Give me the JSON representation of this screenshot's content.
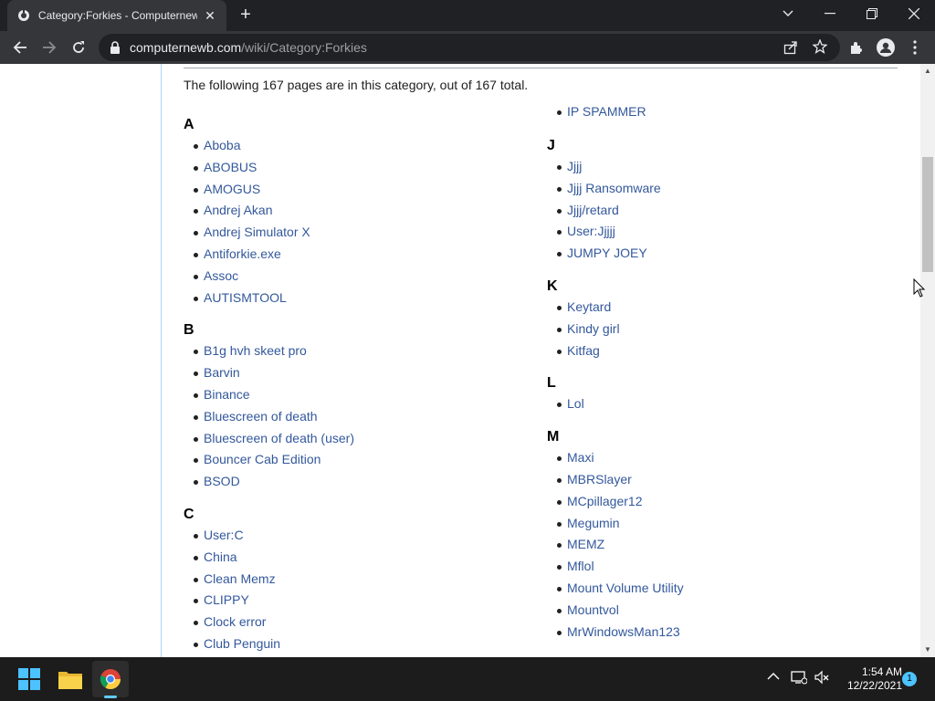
{
  "browser": {
    "tab_title": "Category:Forkies - Computernewb",
    "tab_close": "✕",
    "new_tab": "+",
    "url_host": "computernewb.com",
    "url_path": "/wiki/Category:Forkies"
  },
  "page": {
    "intro": "The following 167 pages are in this category, out of 167 total.",
    "left_column": [
      {
        "heading": "A",
        "items": [
          "Aboba",
          "ABOBUS",
          "AMOGUS",
          "Andrej Akan",
          "Andrej Simulator X",
          "Antiforkie.exe",
          "Assoc",
          "AUTISMTOOL"
        ]
      },
      {
        "heading": "B",
        "items": [
          "B1g hvh skeet pro",
          "Barvin",
          "Binance",
          "Bluescreen of death",
          "Bluescreen of death (user)",
          "Bouncer Cab Edition",
          "BSOD"
        ]
      },
      {
        "heading": "C",
        "items": [
          "User:C",
          "China",
          "Clean Memz",
          "CLIPPY",
          "Clock error",
          "Club Penguin"
        ]
      }
    ],
    "right_top_items": [
      "IP SPAMMER"
    ],
    "right_column": [
      {
        "heading": "J",
        "items": [
          "Jjjj",
          "Jjjj Ransomware",
          "Jjjj/retard",
          "User:Jjjjj",
          "JUMPY JOEY"
        ]
      },
      {
        "heading": "K",
        "items": [
          "Keytard",
          "Kindy girl",
          "Kitfag"
        ]
      },
      {
        "heading": "L",
        "items": [
          "Lol"
        ]
      },
      {
        "heading": "M",
        "items": [
          "Maxi",
          "MBRSlayer",
          "MCpillager12",
          "Megumin",
          "MEMZ",
          "Mflol",
          "Mount Volume Utility",
          "Mountvol",
          "MrWindowsMan123"
        ]
      }
    ]
  },
  "taskbar": {
    "time": "1:54 AM",
    "date": "12/22/2021",
    "notification_count": "1"
  },
  "colors": {
    "link": "#33589c",
    "chrome_dark": "#202124",
    "chrome_tab": "#35363a",
    "taskbar": "#1c1c1c",
    "accent": "#60cdff"
  }
}
